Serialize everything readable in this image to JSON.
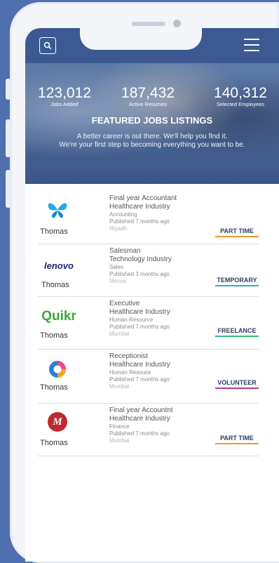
{
  "header": {
    "search_icon": "search-icon",
    "menu_icon": "hamburger-menu-icon"
  },
  "stats": [
    {
      "value": "123,012",
      "label": "Jobs Added"
    },
    {
      "value": "187,432",
      "label": "Active Resumes"
    },
    {
      "value": "140,312",
      "label": "Selected Employees"
    }
  ],
  "hero": {
    "title": "FEATURED JOBS LISTINGS",
    "subtitle_line1": "A better career is out there. We'll help you find it.",
    "subtitle_line2": "We're your first step to becoming everything you want to be."
  },
  "jobs": [
    {
      "company": "Thomas",
      "title": "Final year Accountant",
      "industry": "Healthcare Industry",
      "department": "Accounting",
      "published": "Published 7 months ago",
      "location": "Riyadh",
      "type": "PART TIME",
      "color": "#f0962e",
      "logo": "butterfly-logo"
    },
    {
      "company": "Thomas",
      "title": "Salesman",
      "industry": "Technology Industry",
      "department": "Sales",
      "published": "Published 3 months ago",
      "location": "Mecca",
      "type": "TEMPORARY",
      "color": "#2bb0b8",
      "logo": "lenovo-logo",
      "logo_text": "lenovo"
    },
    {
      "company": "Thomas",
      "title": "Executive",
      "industry": "Healthcare Industry",
      "department": "Human Resource",
      "published": "Published 7 months ago",
      "location": "Mumbai",
      "type": "FREELANCE",
      "color": "#3cb878",
      "logo": "quikr-logo",
      "logo_text": "Quikr"
    },
    {
      "company": "Thomas",
      "title": "Receptionist",
      "industry": "Healthcare Industry",
      "department": "Human Resouce",
      "published": "Published 7 months ago",
      "location": "Mumbai",
      "type": "VOLUNTEER",
      "color": "#b8369b",
      "logo": "ring-logo"
    },
    {
      "company": "Thomas",
      "title": "Final year Accountnt",
      "industry": "Healthcare Industry",
      "department": "Finance",
      "published": "Published 7 months ago",
      "location": "Mumbai",
      "type": "PART TIME",
      "color": "#f0962e",
      "logo": "m-logo",
      "logo_text": "M"
    }
  ]
}
